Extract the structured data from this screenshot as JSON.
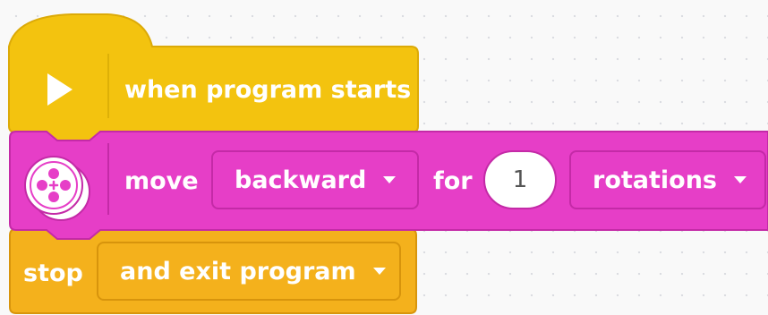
{
  "hat_block": {
    "icon": "play-icon",
    "label": "when program starts",
    "color": "#f3c30f"
  },
  "move_block": {
    "icon": "motor-pair-icon",
    "label": "move",
    "direction": "backward",
    "for_label": "for",
    "amount": "1",
    "unit": "rotations",
    "color": "#e63ec7"
  },
  "stop_block": {
    "label": "stop",
    "option": "and exit program",
    "color": "#f4b11c"
  }
}
